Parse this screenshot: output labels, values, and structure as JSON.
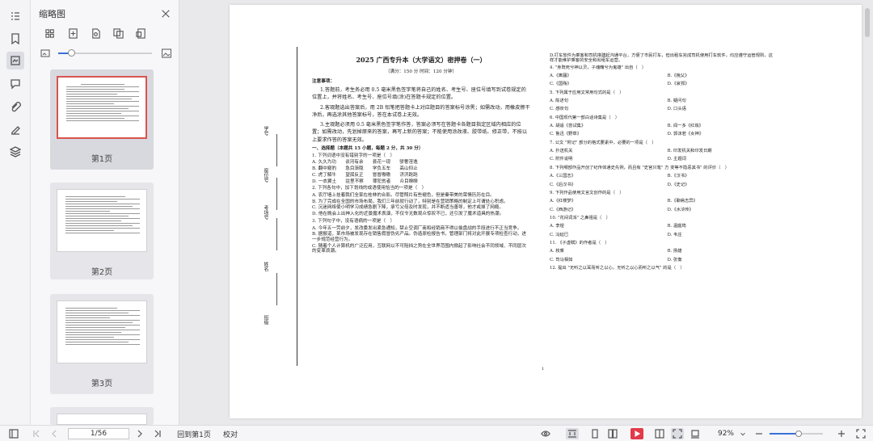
{
  "sidebar": {
    "title": "缩略图",
    "thumbnails": [
      {
        "label": "第1页",
        "selected": true
      },
      {
        "label": "第2页",
        "selected": false
      },
      {
        "label": "第3页",
        "selected": false
      }
    ]
  },
  "document": {
    "title": "2025 广西专升本（大学语文）密押卷（一）",
    "subtitle": "（满分：150 分 时间：120 分钟）",
    "notice_heading": "注意事项：",
    "notices": [
      "1.答题前，考生务必用 0.5 毫米黑色签字笔将自己的姓名、考生号、座位号填写到试卷规定的位置上，并将姓名、考生号、座位号填(涂)在答题卡规定的位置。",
      "2.客观题选出答案后，用 2B 铅笔把答题卡上对应题目的答案标号涂黑；如需改动，用橡皮擦干净后，再选涂其他答案标号，答在本试卷上无效。",
      "3.主观题必须用 0.5 毫米黑色签字笔作答，答案必须写在答题卡各题目指定区域内相应的位置；如需改动，先划掉原来的答案，再写上新的答案；不能使用涂改液、胶带纸、修正带，不按以上要求作答的答案无效。"
    ],
    "section1": "一、选择题（本题共 15 小题，每题 2 分，共 30 分）",
    "binding_labels": [
      "学号",
      "座位号",
      "考场号",
      "姓名",
      "班级"
    ],
    "left_questions": [
      {
        "q": "1. 下列词语中没有错别字的一项是（　）",
        "opts": [
          "A. 久久为功　　谈河有余　　县花一现　　骄奢淫逸",
          "B. 翻中窥豹　　急目渐隐　　学负五车　　高山仰止",
          "C. 虎丁解牛　　望孤反正　　冒冒嗷嗷　　济济跄跄",
          "D. 一衣翼土　　驻里不察　　罪犯贫者　　众目睽睽"
        ]
      },
      {
        "q": "2. 下列各句中，加下划线的成语使用恰当的一项是（　）",
        "opts": [
          "A. 农厅墙上挂着我们全家在桂林的合影。尽管照片有些褪色，但是秦带美的荣情历历在目。",
          "B. 为了完成在全国的市场布局，我们三年前就行动了，特别是在营销策略的制定上可谓处心积虑。",
          "C. 沉迷网络使小明学习成绩急剧下降，承亏父母及时发现，并不断适当善导，他才戒掉了网瘾。",
          "D. 他在晚会上出神入化的近景魔术表演，不仅令无数观众惊叹不已，还引发了魔术道具的热潮。"
        ]
      },
      {
        "q": "3. 下列句子中，没有语病的一项是（　）",
        "opts": [
          "A. 今年五一劳前夕，发改委发出紧急通知，禁止空调厂商和经销商不得以偷盘战的手段进行不正当竞争。",
          "B. 据报道，某市场被发现存在销售假冒伪劣产品。伪造原检报告书，管理部门将对此开展专项检查行动，进一步规范经营行为。",
          "C. 随着个人计算机的广泛应用，互联网以不可阻挡之势在全世界范围内掀起了影响社会不同领域、不同层次的变革浪潮。"
        ]
      }
    ],
    "right_intro": "D.打车软件为乘客和司机搭建起沟通平台，方便了市民打车，但出租车完成司机使用打车软件，均应遵守运管规则，这样才能维护乘客的安全和出租车运营。",
    "right_questions": [
      {
        "q": "4. \"身既死兮神以灵，子魂魄兮为鬼雄\" 出自（　）",
        "opts": [
          "A.《离骚》",
          "B.《挽父》",
          "C.《国殇》",
          "D.《哀郢》"
        ]
      },
      {
        "q": "5. 下列属于应用文常用句式的是（　）",
        "opts": [
          "A. 陈述句",
          "B. 疑问句",
          "C. 感叹句",
          "D. 口头语"
        ]
      },
      {
        "q": "6. 中国现代第一部白话诗集是（　）",
        "opts": [
          "A. 胡适《尝试集》",
          "B. 闻一多《红烛》",
          "C. 鲁迅《野草》",
          "D. 郭沫若《女神》"
        ]
      },
      {
        "q": "7. 公文 \"附记\" 部分的格式要素中，必要的一项是（　）",
        "opts": [
          "A. 抄送机关",
          "B. 印发机关和印发日期",
          "C. 附件说明",
          "D. 主题词"
        ]
      },
      {
        "q": "8. 下列哪部作品开创了纪传体通史先例，而且有 \"史官只笔\" 方 变等不隐恶其书\" 的评价（　）",
        "opts": [
          "A.《三国志》",
          "B.《汉书》",
          "C.《后汉书》",
          "D.《史记》"
        ]
      },
      {
        "q": "9. 下列作品使用文言文创作的是（　）",
        "opts": [
          "A.《红楼梦》",
          "B.《聊斋志异》",
          "C.《西游记》",
          "D.《水浒传》"
        ]
      },
      {
        "q": "10. \"花间词派\" 之鼻祖是（　）",
        "opts": [
          "A. 李煜",
          "B. 温庭筠",
          "C. 冯延巳",
          "D. 韦庄"
        ]
      },
      {
        "q": "11. 《子虚赋》的作者是（　）",
        "opts": [
          "A. 枚乘",
          "B. 扬雄",
          "C. 司马相如",
          "D. 张衡"
        ]
      },
      {
        "q": "12. 提出 \"无听之以耳而听之以心，无听之以心而听之以气\" 的是（　）",
        "opts": []
      }
    ],
    "page_number": "1"
  },
  "statusbar": {
    "page_input": "1/56",
    "goto_first": "回到第1页",
    "proofread": "校对",
    "zoom": "92%"
  }
}
